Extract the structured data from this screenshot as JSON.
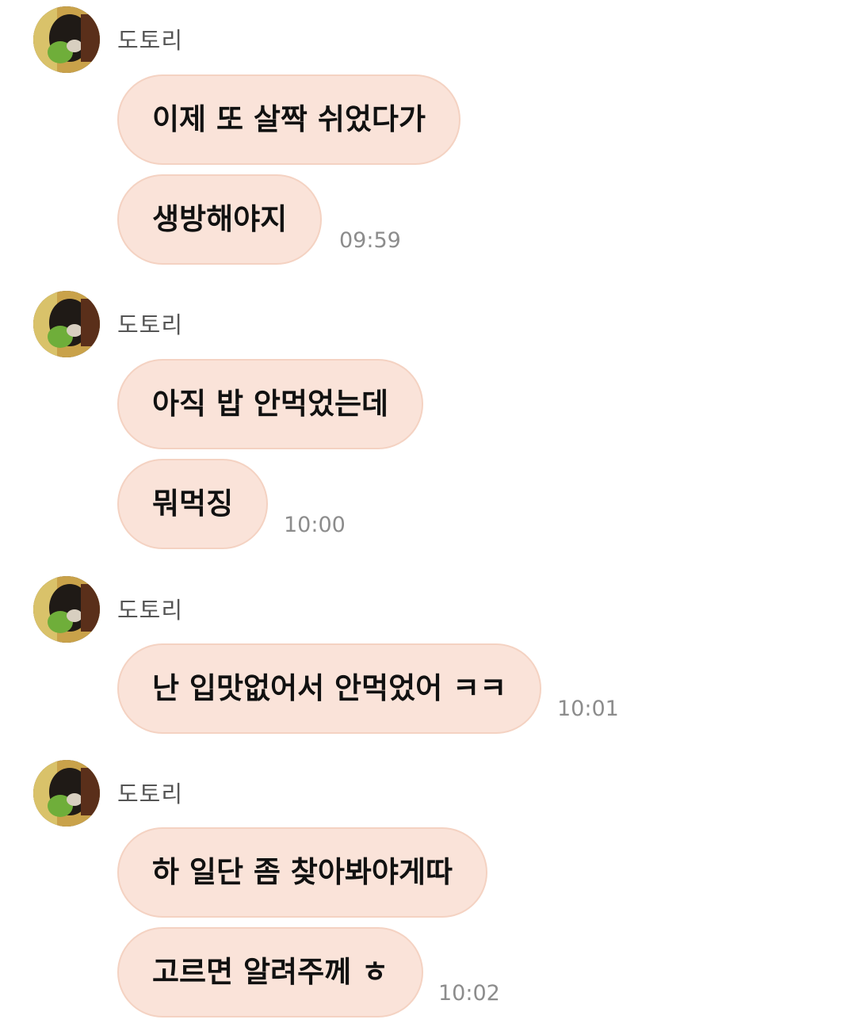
{
  "groups": [
    {
      "sender": "도토리",
      "messages": [
        "이제 또 살짝 쉬었다가",
        "생방해야지"
      ],
      "time": "09:59"
    },
    {
      "sender": "도토리",
      "messages": [
        "아직 밥 안먹었는데",
        "뭐먹징"
      ],
      "time": "10:00"
    },
    {
      "sender": "도토리",
      "messages": [
        "난 입맛없어서 안먹었어 ㅋㅋ"
      ],
      "time": "10:01"
    },
    {
      "sender": "도토리",
      "messages": [
        "하 일단 좀 찾아봐야게따",
        "고르면 알려주께 ㅎ"
      ],
      "time": "10:02"
    }
  ],
  "colors": {
    "bubble": "#fae3d9",
    "bubble_border": "#f4d2c2",
    "sender_text": "#555555",
    "time_text": "#8c8c8c"
  }
}
